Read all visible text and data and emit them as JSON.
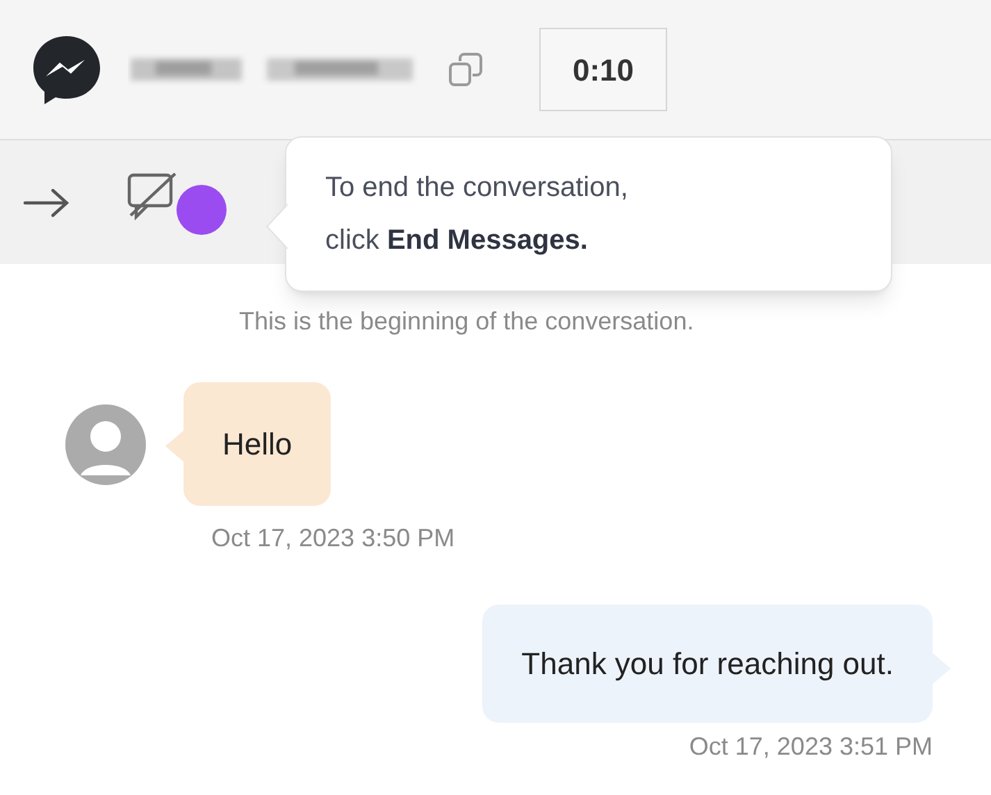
{
  "header": {
    "timer": "0:10"
  },
  "tooltip": {
    "text": "To end the conversation, click **End Messages.**"
  },
  "conversation": {
    "intro": "This is the beginning of the conversation.",
    "messages": [
      {
        "kind": "incoming",
        "text": "Hello",
        "time": "Oct 17, 2023 3:50 PM"
      },
      {
        "kind": "outgoing",
        "text": "Thank you for reaching out.",
        "time": "Oct 17, 2023 3:51 PM"
      }
    ]
  }
}
